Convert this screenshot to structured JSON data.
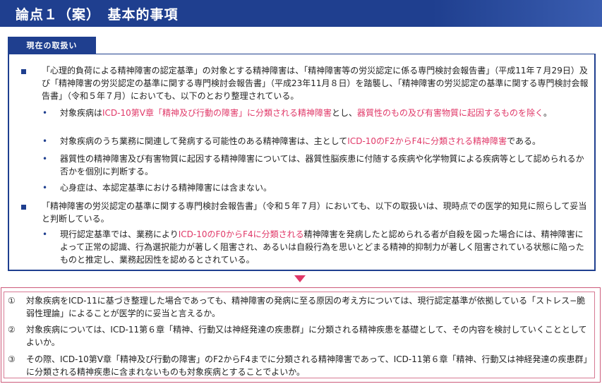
{
  "header": {
    "title": "論点１（案）　基本的事項"
  },
  "section": {
    "tab_label": "現在の取扱い"
  },
  "current": {
    "p1": "「心理的負荷による精神障害の認定基準」の対象とする精神障害は、「精神障害等の労災認定に係る専門検討会報告書」（平成11年７月29日）及び「精神障害の労災認定の基準に関する専門検討会報告書」（平成23年11月８日）を踏襲し、「精神障害の労災認定の基準に関する専門検討会報告書」（令和５年７月）においても、以下のとおり整理されている。",
    "s1_a": "対象疾病は",
    "s1_b": "ICD-10第Ⅴ章「精神及び行動の障害」に分類される精神障害",
    "s1_c": "とし、",
    "s1_d": "器質性のもの及び有害物質に起因するものを除く",
    "s1_e": "。",
    "s2_a": "対象疾病のうち業務に関連して発病する可能性のある精神障害は、主として",
    "s2_b": "ICD-10のF2からF4に分類される精神障害",
    "s2_c": "である。",
    "s3": "器質性の精神障害及び有害物質に起因する精神障害については、器質性脳疾患に付随する疾病や化学物質による疾病等として認められるか否かを個別に判断する。",
    "s4": "心身症は、本認定基準における精神障害には含まない。",
    "p2": "「精神障害の労災認定の基準に関する専門検討会報告書」（令和５年７月）においても、以下の取扱いは、現時点での医学的知見に照らして妥当と判断している。",
    "s5_a": "現行認定基準では、業務により",
    "s5_b": "ICD-10のF0からF4に分類される",
    "s5_c": "精神障害を発病したと認められる者が自殺を図った場合には、精神障害によって正常の認識、行為選択能力が著しく阻害され、あるいは自殺行為を思いとどまる精神的抑制力が著しく阻害されている状態に陥ったものと推定し、業務起因性を認めるとされている。"
  },
  "issues": [
    {
      "num": "①",
      "text": "対象疾病をICD-11に基づき整理した場合であっても、精神障害の発病に至る原因の考え方については、現行認定基準が依拠している「ストレス−脆弱性理論」によることが医学的に妥当と言えるか。"
    },
    {
      "num": "②",
      "text": "対象疾病については、ICD-11第６章「精神、行動又は神経発達の疾患群」に分類される精神疾患を基礎として、その内容を検討していくこととしてよいか。"
    },
    {
      "num": "③",
      "text": "その際、ICD-10第Ⅴ章「精神及び行動の障害」のF2からF4までに分類される精神障害であって、ICD-11第６章「精神、行動又は神経発達の疾患群」に分類される精神疾患に含まれないものも対象疾病とすることでよいか。"
    }
  ],
  "colors": {
    "primary": "#1f3f8f",
    "accent": "#e03868"
  }
}
